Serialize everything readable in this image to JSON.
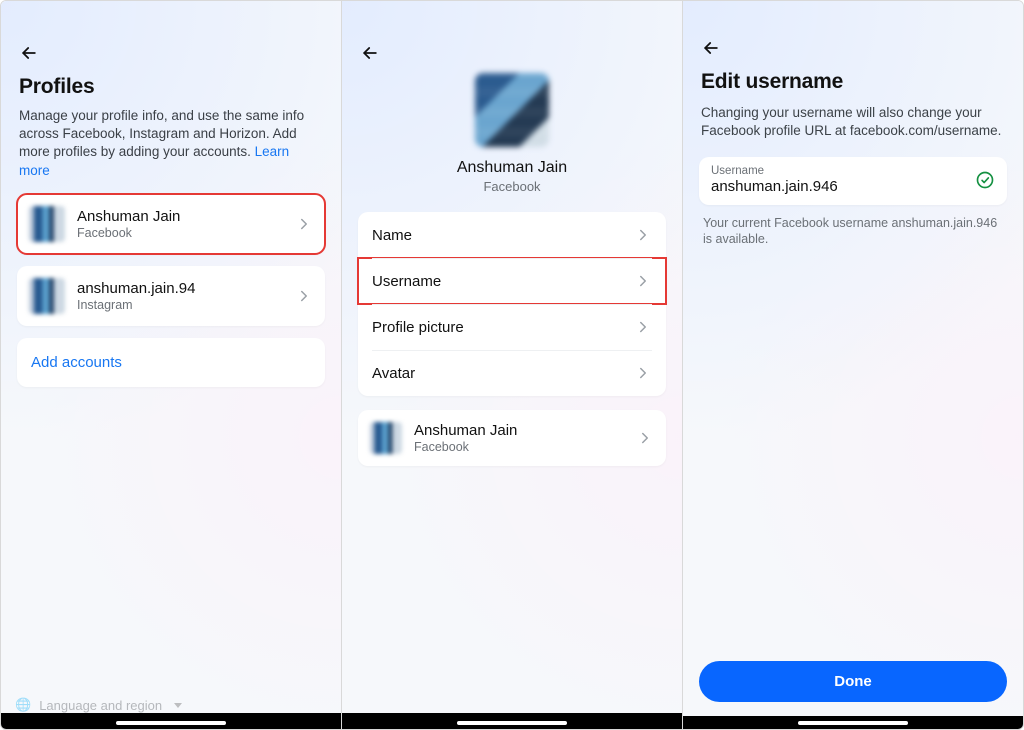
{
  "screen1": {
    "title": "Profiles",
    "description": "Manage your profile info, and use the same info across Facebook, Instagram and Horizon. Add more profiles by adding your accounts. ",
    "learn_more": "Learn more",
    "profiles": [
      {
        "name": "Anshuman Jain",
        "service": "Facebook",
        "highlighted": true
      },
      {
        "name": "anshuman.jain.94",
        "service": "Instagram",
        "highlighted": false
      }
    ],
    "add_accounts": "Add accounts",
    "faded_item": "Language and region"
  },
  "screen2": {
    "profile_name": "Anshuman Jain",
    "profile_service": "Facebook",
    "settings": [
      {
        "label": "Name",
        "highlighted": false
      },
      {
        "label": "Username",
        "highlighted": true
      },
      {
        "label": "Profile picture",
        "highlighted": false
      },
      {
        "label": "Avatar",
        "highlighted": false
      }
    ],
    "account_row": {
      "name": "Anshuman Jain",
      "service": "Facebook"
    }
  },
  "screen3": {
    "title": "Edit username",
    "subtext": "Changing your username will also change your Facebook profile URL at facebook.com/username.",
    "field_label": "Username",
    "field_value": "anshuman.jain.946",
    "availability": "Your current Facebook username anshuman.jain.946 is available.",
    "done": "Done"
  }
}
